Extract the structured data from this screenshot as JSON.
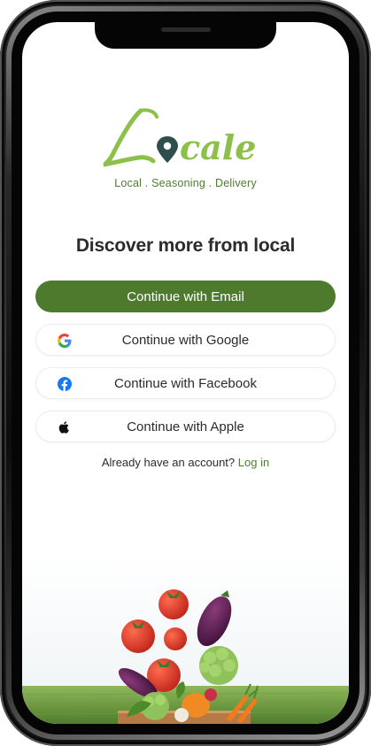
{
  "brand": {
    "logo_text": "Locale",
    "tagline": "Local . Seasoning . Delivery"
  },
  "headline": "Discover more from local",
  "buttons": {
    "email": "Continue with Email",
    "google": "Continue with Google",
    "facebook": "Continue with Facebook",
    "apple": "Continue with Apple"
  },
  "login": {
    "prompt": "Already have an account?",
    "link": "Log in"
  },
  "colors": {
    "brand_green": "#4e7a2e",
    "logo_light_green": "#8cc04a",
    "pin_dark": "#2f4f4f",
    "facebook_blue": "#1877f2"
  },
  "icons": [
    "google-icon",
    "facebook-icon",
    "apple-icon",
    "location-pin-icon"
  ]
}
